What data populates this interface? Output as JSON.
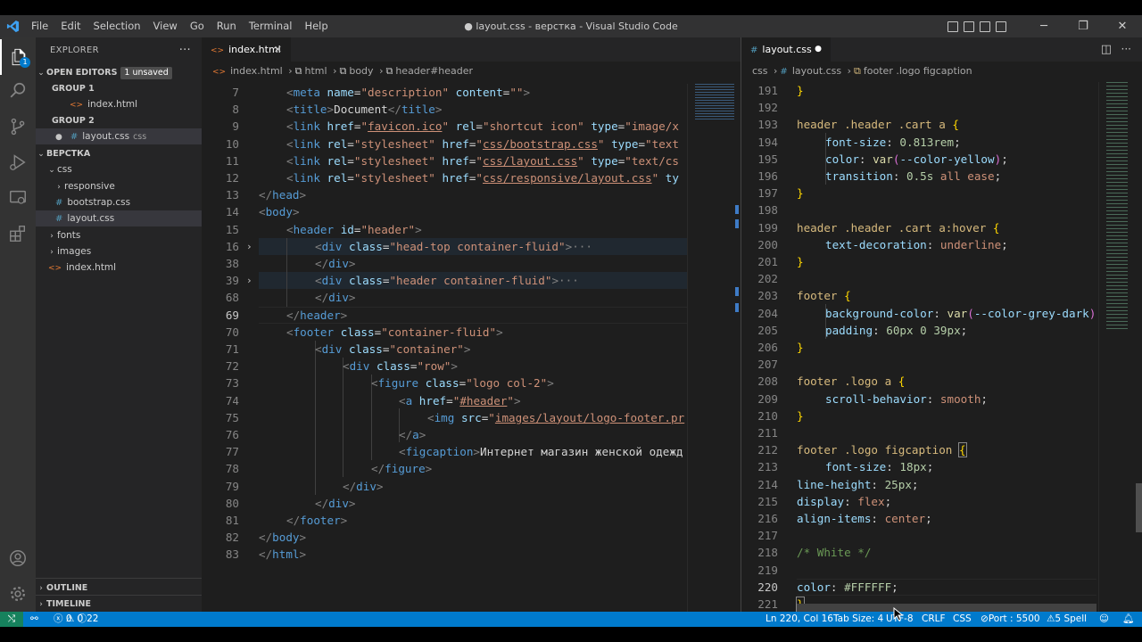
{
  "window": {
    "title": "● layout.css - верстка - Visual Studio Code",
    "menu": [
      "File",
      "Edit",
      "Selection",
      "View",
      "Go",
      "Run",
      "Terminal",
      "Help"
    ]
  },
  "sidebar": {
    "header": "EXPLORER",
    "open_editors": {
      "label": "OPEN EDITORS",
      "badge": "1 unsaved"
    },
    "group1": {
      "label": "GROUP 1",
      "file": "index.html"
    },
    "group2": {
      "label": "GROUP 2",
      "file": "layout.css",
      "suffix": "css"
    },
    "workspace": "ВЕРСТКА",
    "tree": {
      "css": "css",
      "responsive": "responsive",
      "bootstrap": "bootstrap.css",
      "layout": "layout.css",
      "fonts": "fonts",
      "images": "images",
      "index": "index.html"
    },
    "outline": "OUTLINE",
    "timeline": "TIMELINE"
  },
  "left_editor": {
    "tab": "index.html",
    "breadcrumb": [
      "index.html",
      "html",
      "body",
      "header#header"
    ],
    "line_numbers": [
      "7",
      "8",
      "9",
      "10",
      "11",
      "12",
      "13",
      "14",
      "15",
      "16",
      "38",
      "39",
      "68",
      "69",
      "70",
      "71",
      "72",
      "73",
      "74",
      "75",
      "76",
      "77",
      "78",
      "79",
      "80",
      "81",
      "82",
      "83"
    ],
    "current_line": "69"
  },
  "right_editor": {
    "tab": "layout.css",
    "breadcrumb": [
      "css",
      "layout.css",
      "footer .logo figcaption"
    ],
    "line_numbers": [
      "191",
      "192",
      "193",
      "194",
      "195",
      "196",
      "197",
      "198",
      "199",
      "200",
      "201",
      "202",
      "203",
      "204",
      "205",
      "206",
      "207",
      "208",
      "209",
      "210",
      "211",
      "212",
      "213",
      "214",
      "215",
      "216",
      "217",
      "218",
      "219",
      "220",
      "221"
    ],
    "current_line": "220"
  },
  "status": {
    "problems_errors": "0",
    "problems_warnings": "0",
    "info": "22",
    "position": "Ln 220, Col 16",
    "tab_size": "Tab Size: 4",
    "encoding": "UTF-8",
    "eol": "CRLF",
    "language": "CSS",
    "port": "Port : 5500",
    "spell": "5 Spell"
  },
  "colors": {
    "accent": "#007acc",
    "editor_bg": "#1e1e1e",
    "sidebar_bg": "#252526"
  }
}
